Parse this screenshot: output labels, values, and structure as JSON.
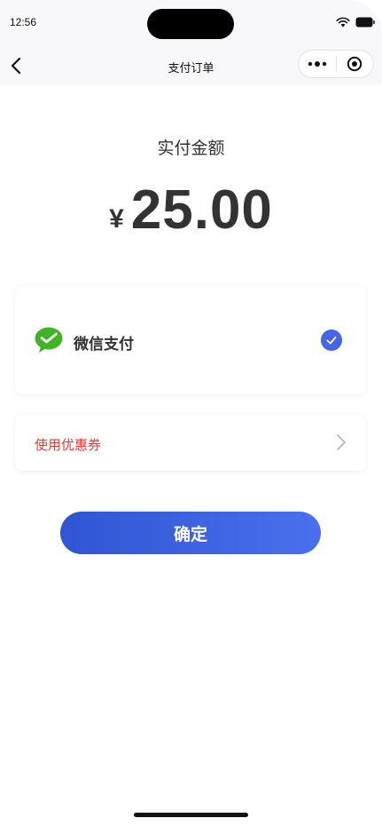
{
  "status_bar": {
    "time": "12:56"
  },
  "nav": {
    "title": "支付订单"
  },
  "payment": {
    "amount_label": "实付金额",
    "currency_symbol": "¥",
    "amount": "25.00"
  },
  "pay_method": {
    "label": "微信支付",
    "selected": true
  },
  "coupon": {
    "label": "使用优惠券"
  },
  "confirm": {
    "label": "确定"
  },
  "colors": {
    "accent": "#4466e6",
    "button_start": "#2f55d4",
    "button_end": "#4a70ee",
    "coupon_text": "#e53935",
    "wechat_green": "#3fb424"
  }
}
